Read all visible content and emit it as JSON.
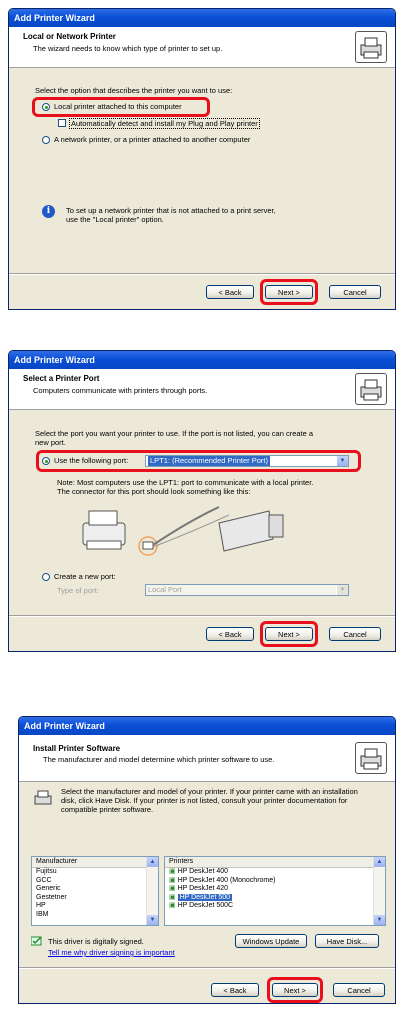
{
  "dialog1": {
    "title": "Add Printer Wizard",
    "header_title": "Local or Network Printer",
    "header_sub": "The wizard needs to know which type of printer to set up.",
    "prompt": "Select the option that describes the printer you want to use:",
    "option_local": "Local printer attached to this computer",
    "option_local_checked": true,
    "autodetect": "Automatically detect and install my Plug and Play printer",
    "option_network": "A network printer, or a printer attached to another computer",
    "info_line1": "To set up a network printer that is not attached to a print server,",
    "info_line2": "use the \"Local printer\" option.",
    "back": "< Back",
    "next": "Next >",
    "cancel": "Cancel"
  },
  "dialog2": {
    "title": "Add Printer Wizard",
    "header_title": "Select a Printer Port",
    "header_sub": "Computers communicate with printers through ports.",
    "prompt_line1": "Select the port you want your printer to use.  If the port is not listed, you can create a",
    "prompt_line2": "new port.",
    "use_port_label": "Use the following port:",
    "use_port_value": "LPT1: (Recommended Printer Port)",
    "note_line1": "Note: Most computers use the LPT1: port to communicate with a local printer.",
    "note_line2": "The connector for this port should look something like this:",
    "create_port_label": "Create a new port:",
    "type_of_port_label": "Type of port:",
    "type_of_port_value": "Local Port",
    "back": "< Back",
    "next": "Next >",
    "cancel": "Cancel"
  },
  "dialog3": {
    "title": "Add Printer Wizard",
    "header_title": "Install Printer Software",
    "header_sub": "The manufacturer and model determine which printer software to use.",
    "desc_line1": "Select the manufacturer and model of your printer. If your printer came with an installation",
    "desc_line2": "disk, click Have Disk. If your printer is not listed, consult your printer documentation for",
    "desc_line3": "compatible printer software.",
    "manufacturer_header": "Manufacturer",
    "manufacturers": [
      "Fujitsu",
      "GCC",
      "Generic",
      "Gestetner",
      "HP",
      "IBM"
    ],
    "printers_header": "Printers",
    "printers": [
      "HP DeskJet 400",
      "HP DeskJet 400 (Monochrome)",
      "HP DeskJet 420",
      "HP DeskJet 500",
      "HP DeskJet 500C"
    ],
    "selected_printer": "HP DeskJet 500",
    "signed_text": "This driver is digitally signed.",
    "signing_link": "Tell me why driver signing is important",
    "windows_update": "Windows Update",
    "have_disk": "Have Disk...",
    "back": "< Back",
    "next": "Next >",
    "cancel": "Cancel"
  },
  "colors": {
    "highlight": "#e8101c",
    "titlebar": "#0a4fd6",
    "selection": "#316ac5"
  }
}
